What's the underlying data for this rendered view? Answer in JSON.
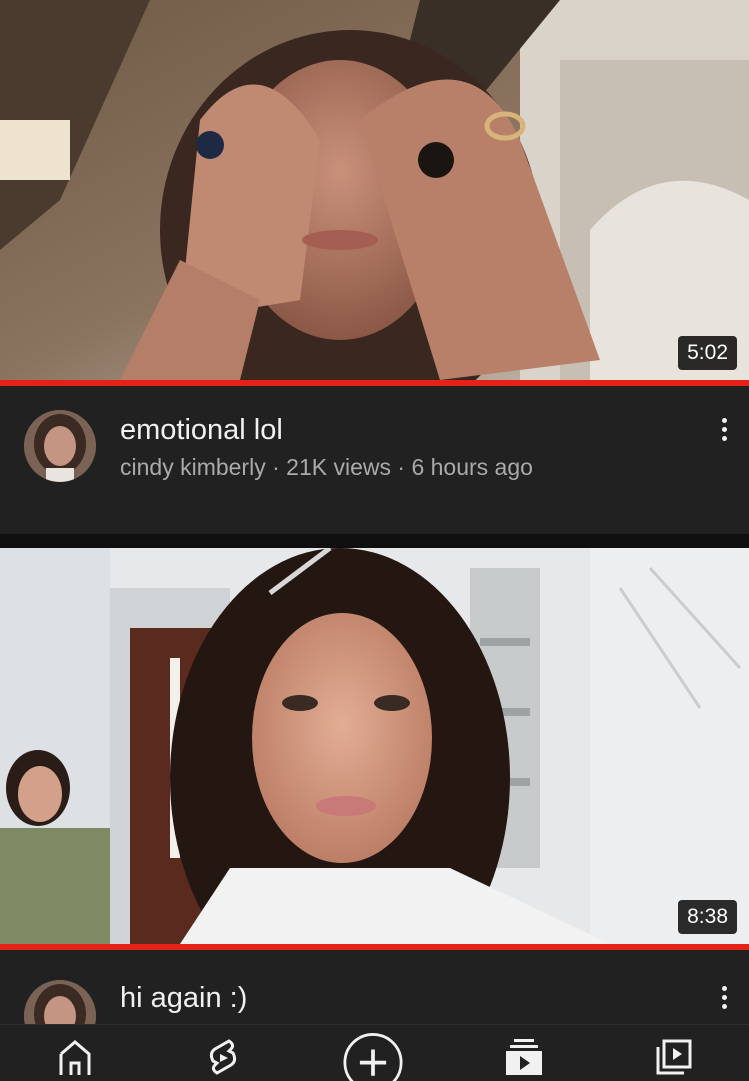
{
  "colors": {
    "background": "#212121",
    "progress": "#e62117",
    "text_primary": "#f1f1f1",
    "text_secondary": "#aaaaaa"
  },
  "videos": [
    {
      "duration": "5:02",
      "watched_fraction": 1.0,
      "title": "emotional lol",
      "channel": "cindy kimberly",
      "views": "21K views",
      "age": "6 hours ago",
      "separator": "·"
    },
    {
      "duration": "8:38",
      "watched_fraction": 1.0,
      "title": "hi again :)"
    }
  ],
  "bottom_nav": {
    "items": [
      {
        "icon": "home-icon"
      },
      {
        "icon": "shorts-icon"
      },
      {
        "icon": "create-icon"
      },
      {
        "icon": "subscriptions-icon"
      },
      {
        "icon": "library-icon"
      }
    ]
  }
}
